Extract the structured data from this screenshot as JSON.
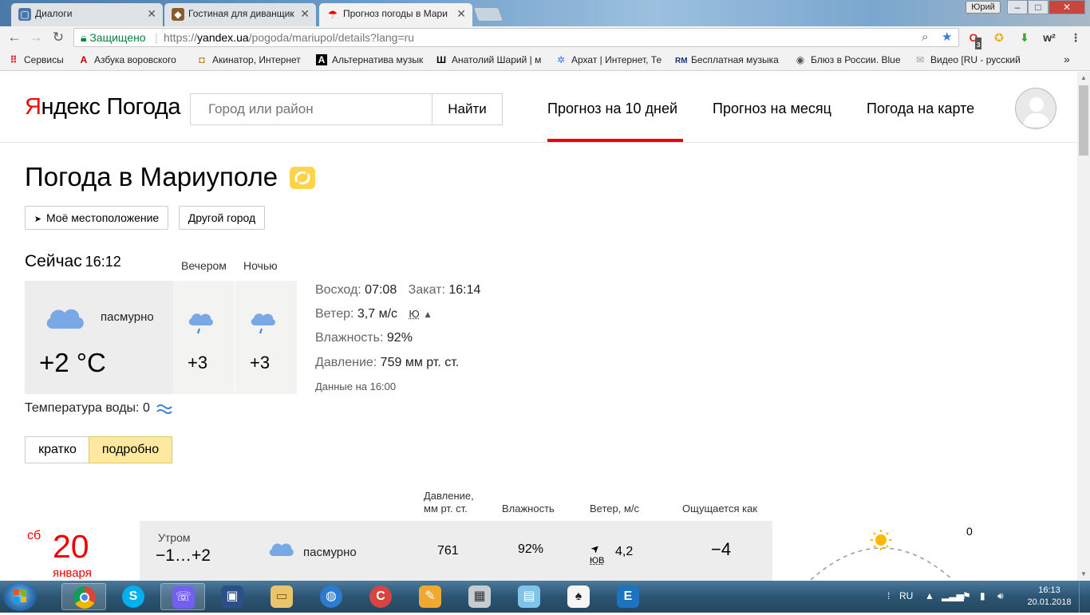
{
  "browser": {
    "tabs": [
      {
        "label": "Диалоги",
        "active": false
      },
      {
        "label": "Гостиная для диванщик",
        "active": false
      },
      {
        "label": "Прогноз погоды в Мари",
        "active": true
      }
    ],
    "user_label": "Юрий",
    "window_controls": {
      "minimize": "–",
      "maximize": "□",
      "close": "✕"
    },
    "secure_label": "Защищено",
    "url_scheme": "https://",
    "url_host": "yandex.ua",
    "url_path": "/pogoda/mariupol/details?lang=ru",
    "bookmarks": [
      "Сервисы",
      "Азбука воровского",
      "Акинатор, Интернет",
      "Альтернатива музык",
      "Анатолий Шарий | м",
      "Архат | Интернет, Те",
      "Бесплатная музыка",
      "Блюз в России. Blue",
      "Видео [RU - русский"
    ],
    "bookmark_overflow": "»",
    "ext_badge": "3",
    "ext_w2": "w²"
  },
  "header": {
    "logo_ya": "Я",
    "logo_rest": "ндекс",
    "logo_service": "Погода",
    "search_placeholder": "Город или район",
    "search_button": "Найти",
    "nav": [
      "Прогноз на 10 дней",
      "Прогноз на месяц",
      "Погода на карте"
    ]
  },
  "main": {
    "title": "Погода в Мариуполе",
    "my_location": "Моё местоположение",
    "other_city": "Другой город",
    "now_label": "Сейчас",
    "now_time": "16:12",
    "phase_evening": "Вечером",
    "phase_night": "Ночью",
    "condition": "пасмурно",
    "temp_now": "+2 °C",
    "temp_evening": "+3",
    "temp_night": "+3",
    "sunrise_label": "Восход:",
    "sunrise": "07:08",
    "sunset_label": "Закат:",
    "sunset": "16:14",
    "wind_label": "Ветер:",
    "wind": "3,7 м/с",
    "wind_dir": "Ю",
    "humidity_label": "Влажность:",
    "humidity": "92%",
    "pressure_label": "Давление:",
    "pressure": "759 мм рт. ст.",
    "data_time": "Данные на 16:00",
    "water_label": "Температура воды:",
    "water_temp": "0",
    "toggle_short": "кратко",
    "toggle_detailed": "подробно"
  },
  "details": {
    "headers": {
      "pressure_1": "Давление,",
      "pressure_2": "мм рт. ст.",
      "humidity": "Влажность",
      "wind": "Ветер, м/с",
      "feels": "Ощущается как"
    },
    "day_of_week": "сб",
    "day_number": "20",
    "month": "января",
    "sun_value": "0",
    "morning": {
      "label": "Утром",
      "temp": "−1…+2",
      "condition": "пасмурно",
      "pressure": "761",
      "humidity": "92%",
      "wind_dir": "ЮВ",
      "wind": "4,2",
      "feels": "−4"
    }
  },
  "taskbar": {
    "lang": "RU",
    "time": "16:13",
    "date": "20.01.2018"
  }
}
